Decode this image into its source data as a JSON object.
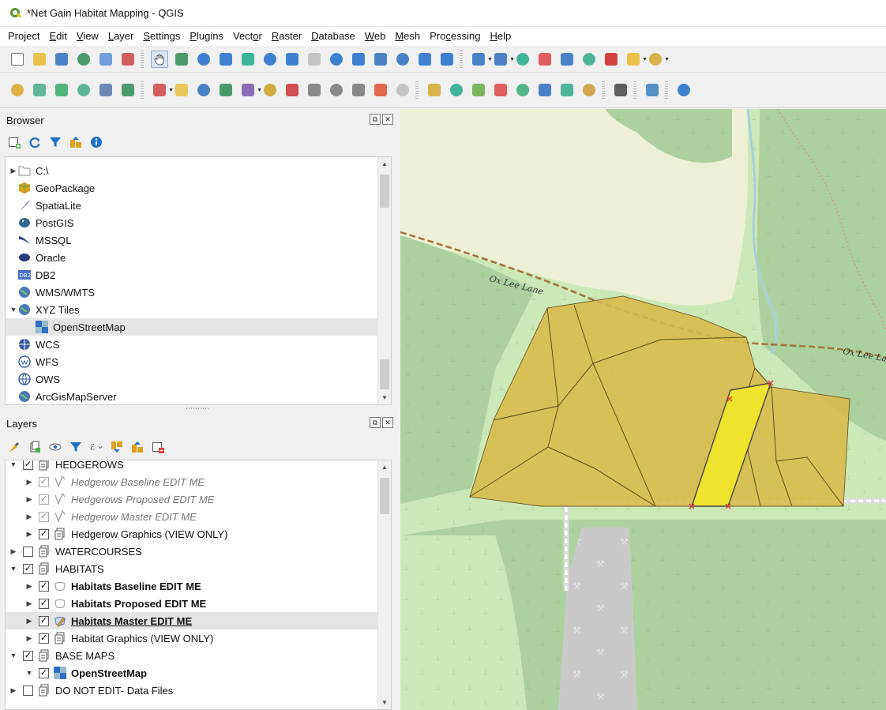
{
  "window": {
    "title": "*Net Gain Habitat Mapping - QGIS"
  },
  "menubar": [
    {
      "label": "Project",
      "mnemonic": ""
    },
    {
      "label": "Edit",
      "mnemonic": "E"
    },
    {
      "label": "View",
      "mnemonic": "V"
    },
    {
      "label": "Layer",
      "mnemonic": "L"
    },
    {
      "label": "Settings",
      "mnemonic": "S"
    },
    {
      "label": "Plugins",
      "mnemonic": "P"
    },
    {
      "label": "Vector",
      "mnemonic": "o"
    },
    {
      "label": "Raster",
      "mnemonic": "R"
    },
    {
      "label": "Database",
      "mnemonic": "D"
    },
    {
      "label": "Web",
      "mnemonic": "W"
    },
    {
      "label": "Mesh",
      "mnemonic": "M"
    },
    {
      "label": "Processing",
      "mnemonic": "c"
    },
    {
      "label": "Help",
      "mnemonic": "H"
    }
  ],
  "browser": {
    "title": "Browser",
    "items": [
      {
        "label": "C:\\",
        "icon": "folder-icon",
        "expander": "collapsed",
        "indent": 0
      },
      {
        "label": "GeoPackage",
        "icon": "geopackage-icon",
        "expander": "none",
        "indent": 0
      },
      {
        "label": "SpatiaLite",
        "icon": "spatialite-icon",
        "expander": "none",
        "indent": 0
      },
      {
        "label": "PostGIS",
        "icon": "postgis-icon",
        "expander": "none",
        "indent": 0
      },
      {
        "label": "MSSQL",
        "icon": "mssql-icon",
        "expander": "none",
        "indent": 0
      },
      {
        "label": "Oracle",
        "icon": "oracle-icon",
        "expander": "none",
        "indent": 0
      },
      {
        "label": "DB2",
        "icon": "db2-icon",
        "expander": "none",
        "indent": 0
      },
      {
        "label": "WMS/WMTS",
        "icon": "globe-icon",
        "expander": "none",
        "indent": 0
      },
      {
        "label": "XYZ Tiles",
        "icon": "globe-icon",
        "expander": "expanded",
        "indent": 0
      },
      {
        "label": "OpenStreetMap",
        "icon": "tiles-icon",
        "expander": "none",
        "indent": 1,
        "selected": true
      },
      {
        "label": "WCS",
        "icon": "wcs-icon",
        "expander": "none",
        "indent": 0
      },
      {
        "label": "WFS",
        "icon": "wfs-icon",
        "expander": "none",
        "indent": 0
      },
      {
        "label": "OWS",
        "icon": "ows-icon",
        "expander": "none",
        "indent": 0
      },
      {
        "label": "ArcGisMapServer",
        "icon": "globe-icon",
        "expander": "none",
        "indent": 0
      }
    ]
  },
  "layers": {
    "title": "Layers",
    "items": [
      {
        "label": "HEDGEROWS",
        "icon": "group-icon",
        "checked": true,
        "expander": "expanded",
        "indent": 0,
        "style": "normal"
      },
      {
        "label": "Hedgerow Baseline EDIT ME",
        "icon": "line-layer-icon",
        "checked": true,
        "expander": "collapsed",
        "indent": 1,
        "style": "italic",
        "grey": true
      },
      {
        "label": "Hedgerows Proposed EDIT ME",
        "icon": "line-layer-icon",
        "checked": true,
        "expander": "collapsed",
        "indent": 1,
        "style": "italic",
        "grey": true
      },
      {
        "label": "Hedgerow Master EDIT ME",
        "icon": "line-layer-icon",
        "checked": true,
        "expander": "collapsed",
        "indent": 1,
        "style": "italic",
        "grey": true
      },
      {
        "label": "Hedgerow Graphics (VIEW ONLY)",
        "icon": "group-icon",
        "checked": true,
        "expander": "collapsed",
        "indent": 1,
        "style": "normal"
      },
      {
        "label": "WATERCOURSES",
        "icon": "group-icon",
        "checked": false,
        "expander": "collapsed",
        "indent": 0,
        "style": "normal"
      },
      {
        "label": "HABITATS",
        "icon": "group-icon",
        "checked": true,
        "expander": "expanded",
        "indent": 0,
        "style": "normal"
      },
      {
        "label": "Habitats Baseline EDIT ME",
        "icon": "polygon-layer-icon",
        "checked": true,
        "expander": "collapsed",
        "indent": 1,
        "style": "bold"
      },
      {
        "label": "Habitats Proposed EDIT ME",
        "icon": "polygon-layer-icon",
        "checked": true,
        "expander": "collapsed",
        "indent": 1,
        "style": "bold"
      },
      {
        "label": "Habitats Master EDIT ME",
        "icon": "pencil-layer-icon",
        "checked": true,
        "expander": "collapsed",
        "indent": 1,
        "style": "bold-underline",
        "selected": true
      },
      {
        "label": "Habitat Graphics (VIEW ONLY)",
        "icon": "group-icon",
        "checked": true,
        "expander": "collapsed",
        "indent": 1,
        "style": "normal"
      },
      {
        "label": "BASE MAPS",
        "icon": "group-icon",
        "checked": true,
        "expander": "expanded",
        "indent": 0,
        "style": "normal"
      },
      {
        "label": "OpenStreetMap",
        "icon": "tiles-icon",
        "checked": true,
        "expander": "expanded",
        "indent": 1,
        "style": "bold"
      },
      {
        "label": "DO NOT EDIT- Data Files",
        "icon": "group-icon",
        "checked": false,
        "expander": "collapsed",
        "indent": 0,
        "style": "normal"
      }
    ]
  },
  "map": {
    "road_labels": [
      "Ox Lee Lane",
      "Ox Lee Lan"
    ],
    "colors": {
      "forest": "#add19e",
      "meadow": "#cde8b7",
      "farmland": "#eef0d5",
      "industrial": "#c8c8c8",
      "habitat_polygon": "#d8b94a",
      "selected_polygon": "#efe32e",
      "stream": "#aad3df"
    }
  }
}
